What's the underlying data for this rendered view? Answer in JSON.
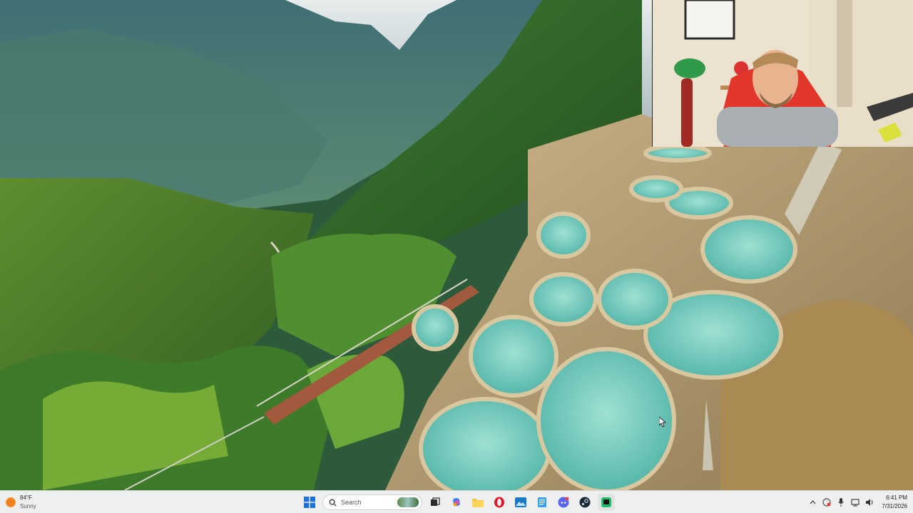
{
  "weather": {
    "temperature": "84°F",
    "condition": "Sunny"
  },
  "search": {
    "placeholder": "Search"
  },
  "taskbar_icons": [
    "windows-start-icon",
    "search-icon",
    "task-view-icon",
    "copilot-icon",
    "file-explorer-icon",
    "opera-icon",
    "photos-icon",
    "notepad-icon",
    "discord-icon",
    "steam-icon",
    "active-app-icon"
  ],
  "tray": {
    "time": "6:41 PM",
    "date": "7/31/2026"
  },
  "colors": {
    "taskbar": "#eef0ef",
    "accent": "#0067c0",
    "pool": "#7ecfc0"
  }
}
